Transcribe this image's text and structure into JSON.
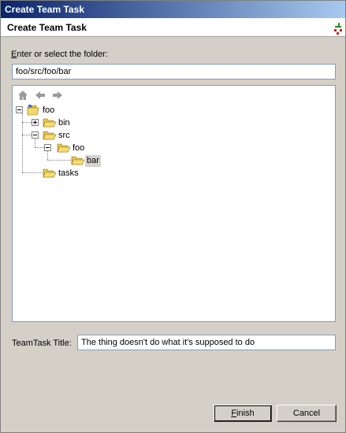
{
  "window": {
    "title": "Create Team Task"
  },
  "banner": {
    "title": "Create Team Task",
    "icon": "wizard-icon"
  },
  "folder": {
    "label_underlined": "E",
    "label_rest": "nter or select the folder:",
    "path_value": "foo/src/foo/bar"
  },
  "tree_toolbar": [
    {
      "name": "home-icon"
    },
    {
      "name": "back-arrow-icon"
    },
    {
      "name": "forward-arrow-icon"
    }
  ],
  "tree": {
    "nodes": [
      {
        "label": "foo",
        "level": 0,
        "expanded": true,
        "icon": "folder-open-icon"
      },
      {
        "label": "bin",
        "level": 1,
        "expanded": false,
        "icon": "folder-icon"
      },
      {
        "label": "src",
        "level": 1,
        "expanded": true,
        "icon": "folder-icon"
      },
      {
        "label": "foo",
        "level": 2,
        "expanded": true,
        "icon": "folder-icon"
      },
      {
        "label": "bar",
        "level": 3,
        "selected": true,
        "icon": "folder-icon"
      },
      {
        "label": "tasks",
        "level": 1,
        "icon": "folder-icon"
      }
    ]
  },
  "team_task": {
    "label": "TeamTask Title:",
    "value": "The thing doesn't do what it's supposed to do"
  },
  "buttons": {
    "finish_underlined": "F",
    "finish_rest": "inish",
    "cancel": "Cancel"
  },
  "colors": {
    "titlebar_start": "#0a246a",
    "titlebar_end": "#a6caf0",
    "dialog_bg": "#d4d0c8"
  }
}
